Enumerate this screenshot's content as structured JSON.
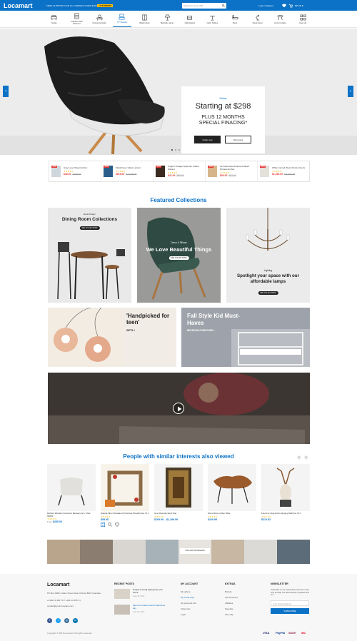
{
  "brand": {
    "logo": "Locamart",
    "accent": "#0c72c7"
  },
  "topbar": {
    "promo_prefix": "FREE SHIPPING FOR ALL ORDERS OVER $199",
    "promo_code": "LOCAMART",
    "search_placeholder": "Search for your stuff",
    "account": "Login / Register",
    "cart_total": "$35.00 $"
  },
  "categories": [
    {
      "label": "Sofas",
      "icon": "sofa-icon"
    },
    {
      "label": "Cabinet with Shelves",
      "icon": "cabinet-icon"
    },
    {
      "label": "Dressing table",
      "icon": "dressing-table-icon"
    },
    {
      "label": "TV Stands",
      "icon": "tv-stand-icon"
    },
    {
      "label": "Wardrobes",
      "icon": "wardrobe-icon"
    },
    {
      "label": "Bedside lamp",
      "icon": "lamp-icon"
    },
    {
      "label": "Nightstand",
      "icon": "nightstand-icon"
    },
    {
      "label": "Cafe Tables",
      "icon": "cafe-table-icon"
    },
    {
      "label": "Bed",
      "icon": "bed-icon"
    },
    {
      "label": "Desk lamp",
      "icon": "desk-lamp-icon"
    },
    {
      "label": "Accent table",
      "icon": "accent-table-icon"
    },
    {
      "label": "View all",
      "icon": "grid-icon"
    }
  ],
  "hero": {
    "tag": "Sofas",
    "headline": "Starting at $298",
    "subline1": "PLUS 12 MONTHS",
    "subline2": "SPECIAL FINACING*",
    "primary_btn": "Order now",
    "secondary_btn": "Discovers"
  },
  "deals": [
    {
      "badge": "-10%",
      "name": "Gray Level Stag Cushion",
      "stars": "★★★★★",
      "price": "$48.00",
      "old": "$138.00"
    },
    {
      "badge": "-15%",
      "name": "Metal Fever Glass Lantern",
      "stars": "★★★★★",
      "price": "$819.00",
      "old": "$1,198.00"
    },
    {
      "badge": "-20%",
      "name": "Copper Vintage Style 6pc Coffee Scissor",
      "stars": "★★★★★",
      "price": "$41.00",
      "old": "$55.00"
    },
    {
      "badge": "-20%",
      "name": "12 Pack Glass Pinecone Bead Ornaments Set",
      "stars": "★★★★★",
      "price": "$50.00",
      "old": "$82.00"
    },
    {
      "badge": "-20%",
      "name": "White Carved Wood Floral Armoire",
      "stars": "★★★★★",
      "price": "$1,260.00",
      "old": "$2,000.00"
    }
  ],
  "featured": {
    "title": "Featured Collections",
    "tiles": [
      {
        "kicker": "Ends Today!",
        "title": "Dining Room Collections",
        "cta": "SEE COLLECTIONS"
      },
      {
        "kicker": "Decor & Pillows",
        "title": "We Love Beautiful Things",
        "cta": "SEE COLLECTIONS"
      },
      {
        "kicker": "Lighting",
        "title": "Spotlight your space with our affordable lamps",
        "cta": "SEE COLLECTIONS"
      },
      {
        "title": "'Handpicked for teen'",
        "sub": "GIFTS +"
      },
      {
        "title": "Fall Style Kid Must-Haves",
        "sub": "BEDROOM FURNITURE +"
      }
    ]
  },
  "similar": {
    "title": "People with similar interests also viewed",
    "products": [
      {
        "name": "Richard Warrlani Collection Berkeley Arm Chair S6630",
        "stars": "★★★★★",
        "price": "$285.00",
        "prefix": "From"
      },
      {
        "name": "Natural Fiber Woodland Christmas Wreaths Set Of 2",
        "stars": "★★★★★",
        "price": "$95.95",
        "prefix": ""
      },
      {
        "name": "Gray Damask Wool Rug",
        "stars": "★★★★★",
        "price": "$169.99 – $1,299.99",
        "prefix": ""
      },
      {
        "name": "Wood Slice Coffee Table",
        "stars": "★★★★★",
        "price": "$229.99",
        "prefix": ""
      },
      {
        "name": "Faux Fur Stag Rush Hanging Wall Set Of 2",
        "stars": "★★★★★",
        "price": "$213.52",
        "prefix": ""
      }
    ]
  },
  "instagram": {
    "button": "FOLLOW INSTAGRAM"
  },
  "footer": {
    "logo": "Locamart",
    "address": "PO Box 8002 Collins Street West Victoria 8007 Australia",
    "phone": "+1184 23 465 78 7 +184 23 456 74",
    "email": "contact@yourcompany.com",
    "recent_title": "RECENT POSTS",
    "posts": [
      {
        "title": "5 ways to bring Spring into your home",
        "date": "June 30, 2017"
      },
      {
        "title": "Meet the maker behind Valentines day",
        "date": "June 30, 2017"
      }
    ],
    "account_title": "MY ACCOUNT",
    "account_links": [
      "My orders",
      "My credit slips",
      "My personal info",
      "Order info",
      "Login"
    ],
    "extras_title": "EXTRAS",
    "extras_links": [
      "Brands",
      "Gift Vouchers",
      "Affiliates",
      "Specials",
      "Site map"
    ],
    "newsletter_title": "NEWSLETTER",
    "newsletter_text": "Subscribe to our newsletters and don't miss new arrivals, the latest fashion updates and our",
    "email_placeholder": "Your Email Address",
    "subscribe": "SUBSCRIBE",
    "copyright": "Copyright © 2015 Locamart. All rights reserved.",
    "payments": [
      "VISA",
      "PayPal",
      "Skrill",
      "MC"
    ]
  }
}
